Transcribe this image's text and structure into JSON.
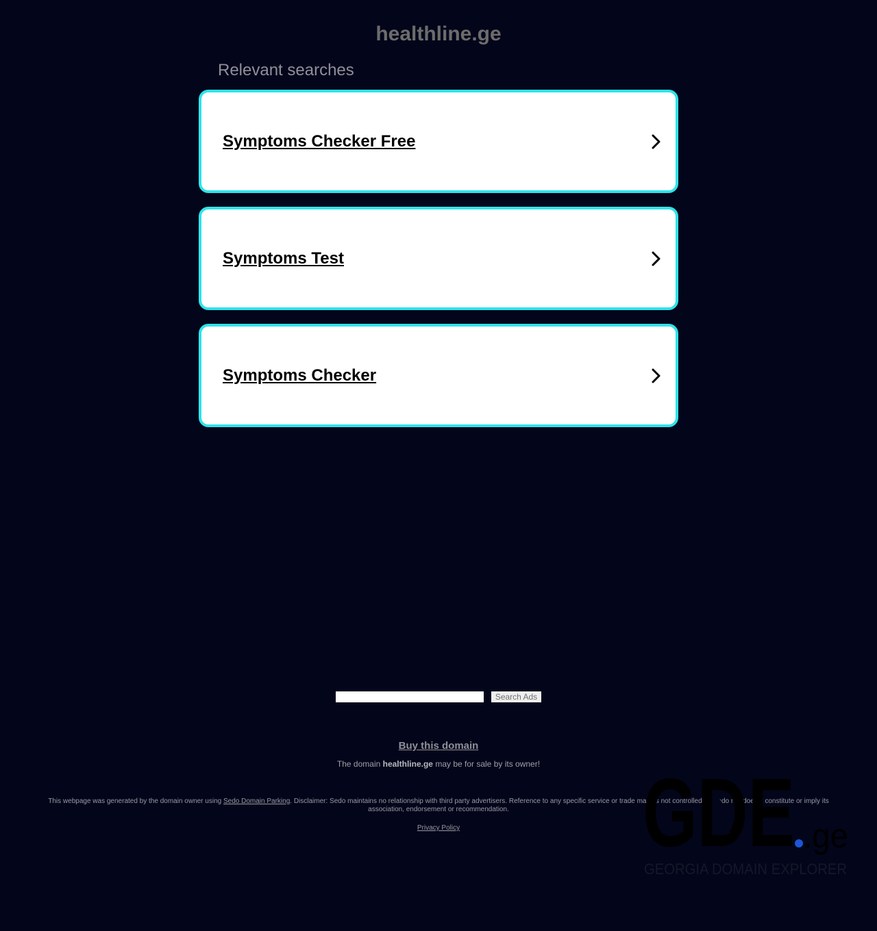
{
  "header": {
    "domain": "healthline.ge",
    "relevant_heading": "Relevant searches"
  },
  "searches": [
    {
      "label": "Symptoms Checker Free",
      "icon": "chevron-right-icon"
    },
    {
      "label": "Symptoms Test",
      "icon": "chevron-right-icon"
    },
    {
      "label": "Symptoms Checker",
      "icon": "chevron-right-icon"
    }
  ],
  "search_bar": {
    "value": "",
    "button_label": "Search Ads"
  },
  "sale": {
    "buy_label": "Buy this domain",
    "prefix": "The domain ",
    "domain": "healthline.ge",
    "suffix": " may be for sale by its owner!"
  },
  "footer": {
    "disclaimer_prefix": "This webpage was generated by the domain owner using ",
    "sedo_link": "Sedo Domain Parking",
    "disclaimer_suffix": ". Disclaimer: Sedo maintains no relationship with third party advertisers. Reference to any specific service or trade mark is not controlled by Sedo nor does it constitute or imply its association, endorsement or recommendation.",
    "privacy_label": "Privacy Policy"
  },
  "watermark": {
    "brand": "GDE",
    "tld": ".ge",
    "tagline": "GEORGIA DOMAIN EXPLORER"
  },
  "colors": {
    "background": "#03051a",
    "card_border": "#2ee3ea",
    "card_background": "#ffffff",
    "title": "#6c6c6c",
    "muted_text": "#8f8f9a",
    "logo_dot": "#1a56d6"
  }
}
